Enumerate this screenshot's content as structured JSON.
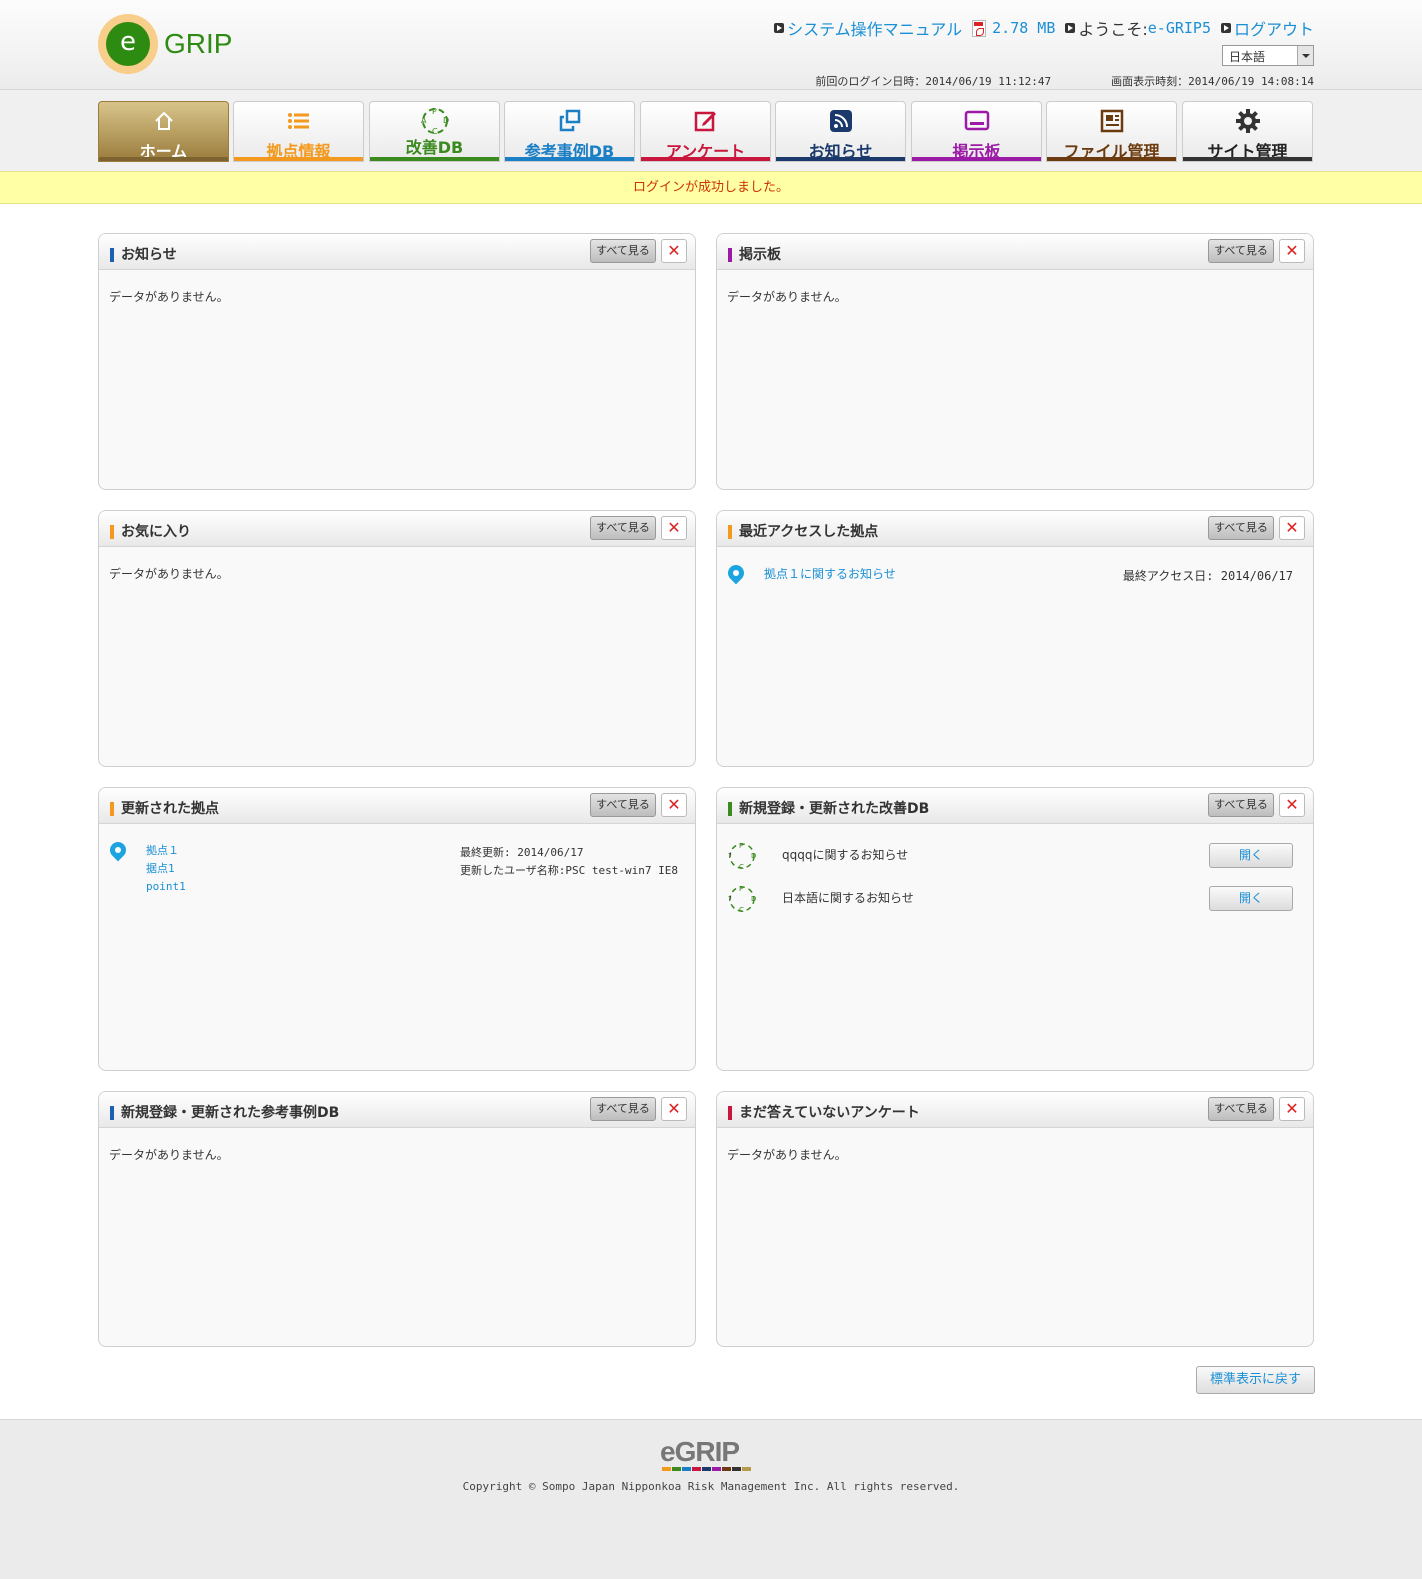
{
  "header": {
    "logo_letter": "e",
    "logo_text": "GRIP",
    "manual_link": "システム操作マニュアル",
    "manual_size": "2.78 MB",
    "welcome_label": "ようこそ: ",
    "user_name": "e-GRIP5",
    "logout": "ログアウト",
    "language": "日本語",
    "last_login": "前回のログイン日時：2014/06/19 11:12:47",
    "display_time": "画面表示時刻：2014/06/19 14:08:14"
  },
  "nav": [
    {
      "label": "ホーム",
      "icon": "home-icon",
      "color": "#9a7c3c",
      "active": true
    },
    {
      "label": "拠点情報",
      "icon": "list-icon",
      "color": "#f39a1e"
    },
    {
      "label": "改善DB",
      "icon": "pdca-icon",
      "color": "#3a8a1e"
    },
    {
      "label": "参考事例DB",
      "icon": "copy-icon",
      "color": "#1a7fc4"
    },
    {
      "label": "アンケート",
      "icon": "edit-icon",
      "color": "#c8163c"
    },
    {
      "label": "お知らせ",
      "icon": "rss-icon",
      "color": "#1b3a6b"
    },
    {
      "label": "掲示板",
      "icon": "board-icon",
      "color": "#9b1aa6"
    },
    {
      "label": "ファイル管理",
      "icon": "file-icon",
      "color": "#6b3a0e"
    },
    {
      "label": "サイト管理",
      "icon": "gear-icon",
      "color": "#333333"
    }
  ],
  "notice": "ログインが成功しました。",
  "common": {
    "see_all": "すべて見る",
    "close": "✕",
    "no_data": "データがありません。",
    "open": "開く"
  },
  "panels": {
    "news": {
      "title": "お知らせ",
      "color": "#1a5fb4"
    },
    "board": {
      "title": "掲示板",
      "color": "#9b1aa6"
    },
    "favorites": {
      "title": "お気に入り",
      "color": "#f39a1e"
    },
    "recent": {
      "title": "最近アクセスした拠点",
      "color": "#f39a1e",
      "item": {
        "link": "拠点１に関するお知らせ",
        "date_label": "最終アクセス日: 2014/06/17"
      }
    },
    "updated_sites": {
      "title": "更新された拠点",
      "color": "#f39a1e",
      "item": {
        "names": [
          "拠点１",
          "据点1",
          "point1"
        ],
        "last_updated": "最終更新: 2014/06/17",
        "updated_by": "更新したユーザ名称:PSC test-win7 IE8"
      }
    },
    "kaizen": {
      "title": "新規登録・更新された改善DB",
      "color": "#3a8a1e",
      "items": [
        {
          "text": "qqqqに関するお知らせ"
        },
        {
          "text": "日本語に関するお知らせ"
        }
      ]
    },
    "reference": {
      "title": "新規登録・更新された参考事例DB",
      "color": "#1a5fb4"
    },
    "survey": {
      "title": "まだ答えていないアンケート",
      "color": "#c8163c"
    }
  },
  "reset_button": "標準表示に戻す",
  "footer": {
    "logo": "eGRIP",
    "bar_colors": [
      "#f39a1e",
      "#3a8a1e",
      "#1a7fc4",
      "#c8163c",
      "#1b3a6b",
      "#9b1aa6",
      "#6b3a0e",
      "#333333",
      "#b59a4a"
    ],
    "copyright": "Copyright © Sompo Japan Nipponkoa Risk Management Inc. All rights reserved."
  }
}
